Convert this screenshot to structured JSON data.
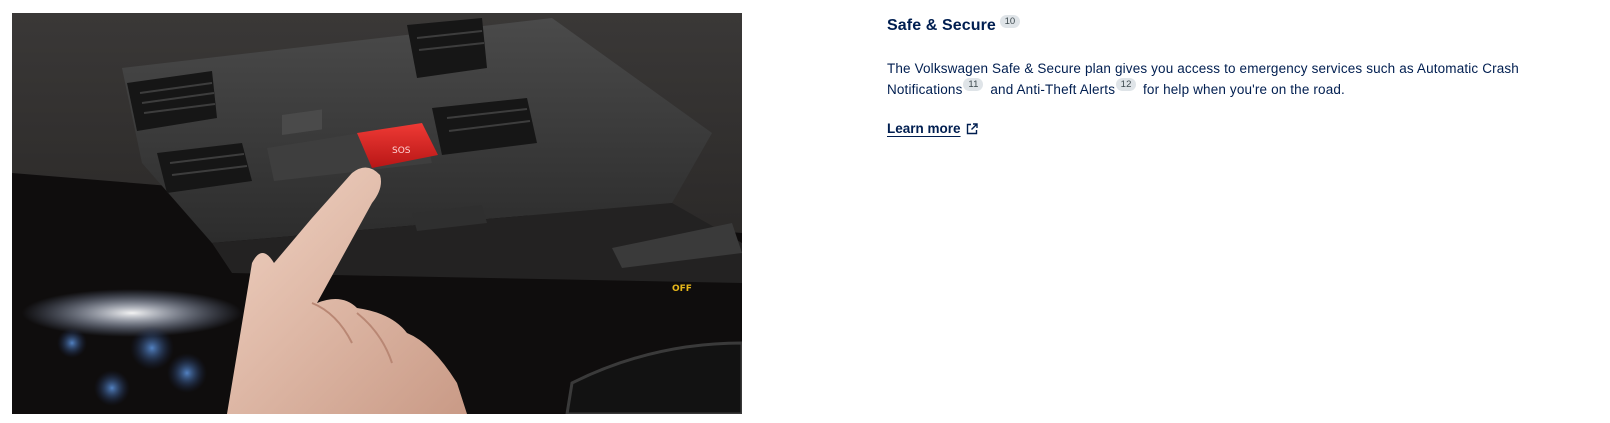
{
  "hero_image": {
    "alt": "Finger pressing red SOS button on overhead console",
    "icon": "sos-button-image"
  },
  "section": {
    "title": "Safe & Secure",
    "title_footnote": "10",
    "description": {
      "part1": "The Volkswagen Safe & Secure plan gives you access to emergency services such as Automatic Crash Notifications",
      "footnote1": "11",
      "part2": "and Anti-Theft Alerts",
      "footnote2": "12",
      "part3": "for help when you're on the road."
    },
    "link_label": "Learn more",
    "link_icon": "external-link-icon"
  },
  "colors": {
    "text": "#001e50",
    "footnote_bg": "#dfe4e8",
    "sos_red": "#d3201f"
  }
}
